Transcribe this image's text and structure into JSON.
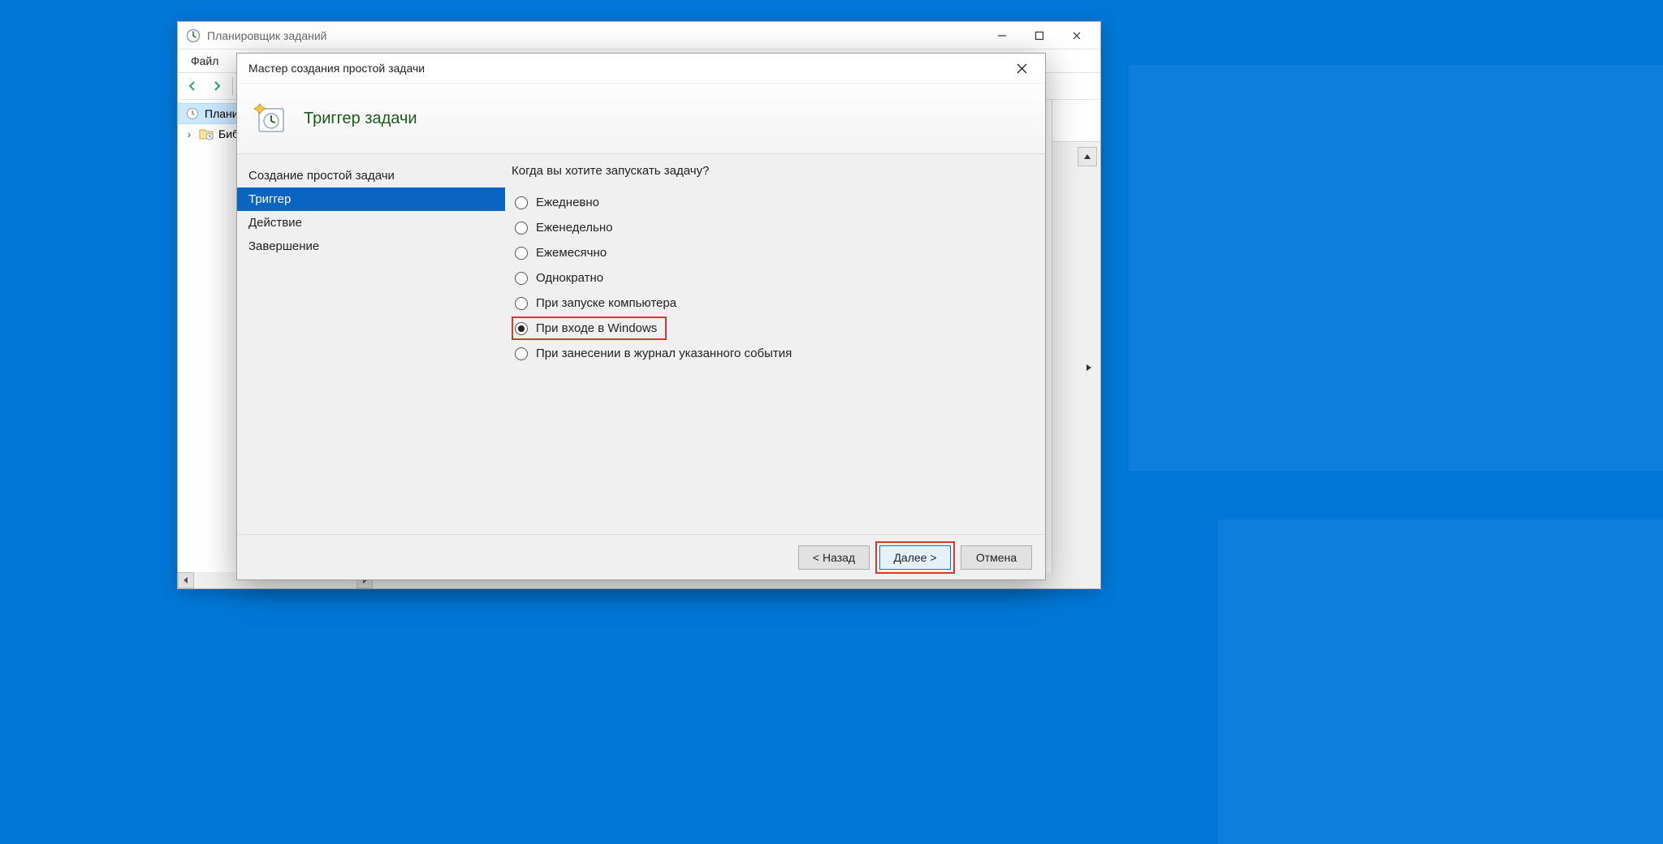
{
  "parentWindow": {
    "title": "Планировщик заданий",
    "menu": {
      "file": "Файл"
    },
    "tree": {
      "root": "Планировщик заданий",
      "library_short": "Библиотека планировщика"
    }
  },
  "wizard": {
    "title": "Мастер создания простой задачи",
    "header": "Триггер задачи",
    "steps": {
      "create": "Создание простой задачи",
      "trigger": "Триггер",
      "action": "Действие",
      "finish": "Завершение"
    },
    "content": {
      "question": "Когда вы хотите запускать задачу?",
      "options": {
        "daily": "Ежедневно",
        "weekly": "Еженедельно",
        "monthly": "Ежемесячно",
        "once": "Однократно",
        "startup": "При запуске компьютера",
        "logon": "При входе в Windows",
        "event": "При занесении в журнал указанного события"
      },
      "selected": "logon"
    },
    "buttons": {
      "back": "< Назад",
      "next": "Далее >",
      "cancel": "Отмена"
    }
  }
}
